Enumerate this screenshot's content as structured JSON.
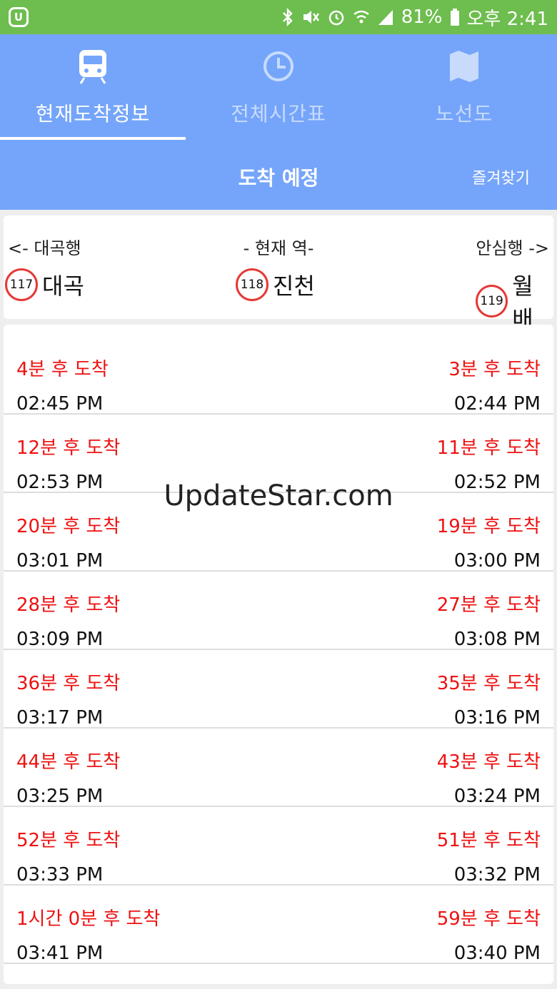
{
  "status_bar": {
    "battery": "81%",
    "time": "오후 2:41",
    "app_icon_text": "U"
  },
  "tabs": [
    {
      "label": "현재도착정보",
      "icon": "train-icon",
      "active": true
    },
    {
      "label": "전체시간표",
      "icon": "clock-icon",
      "active": false
    },
    {
      "label": "노선도",
      "icon": "map-icon",
      "active": false
    }
  ],
  "header": {
    "title": "도착 예정",
    "favorite_label": "즐겨찾기"
  },
  "stations": {
    "left_direction": "<- 대곡행",
    "current_label": "- 현재 역-",
    "right_direction": "안심행 ->",
    "prev": {
      "number": "117",
      "name": "대곡"
    },
    "current": {
      "number": "118",
      "name": "진천"
    },
    "next": {
      "number": "119",
      "name": "월배"
    }
  },
  "arrivals": [
    {
      "left_after": "4분 후 도착",
      "left_time": "02:45 PM",
      "right_after": "3분 후 도착",
      "right_time": "02:44 PM"
    },
    {
      "left_after": "12분 후 도착",
      "left_time": "02:53 PM",
      "right_after": "11분 후 도착",
      "right_time": "02:52 PM"
    },
    {
      "left_after": "20분 후 도착",
      "left_time": "03:01 PM",
      "right_after": "19분 후 도착",
      "right_time": "03:00 PM"
    },
    {
      "left_after": "28분 후 도착",
      "left_time": "03:09 PM",
      "right_after": "27분 후 도착",
      "right_time": "03:08 PM"
    },
    {
      "left_after": "36분 후 도착",
      "left_time": "03:17 PM",
      "right_after": "35분 후 도착",
      "right_time": "03:16 PM"
    },
    {
      "left_after": "44분 후 도착",
      "left_time": "03:25 PM",
      "right_after": "43분 후 도착",
      "right_time": "03:24 PM"
    },
    {
      "left_after": "52분 후 도착",
      "left_time": "03:33 PM",
      "right_after": "51분 후 도착",
      "right_time": "03:32 PM"
    },
    {
      "left_after": "1시간 0분 후 도착",
      "left_time": "03:41 PM",
      "right_after": "59분 후 도착",
      "right_time": "03:40 PM"
    }
  ],
  "watermark": "UpdateStar.com",
  "colors": {
    "status_bar": "#6ebd4f",
    "primary": "#75a5fa",
    "arrival_text": "#ee1111",
    "station_ring": "#e53935"
  }
}
